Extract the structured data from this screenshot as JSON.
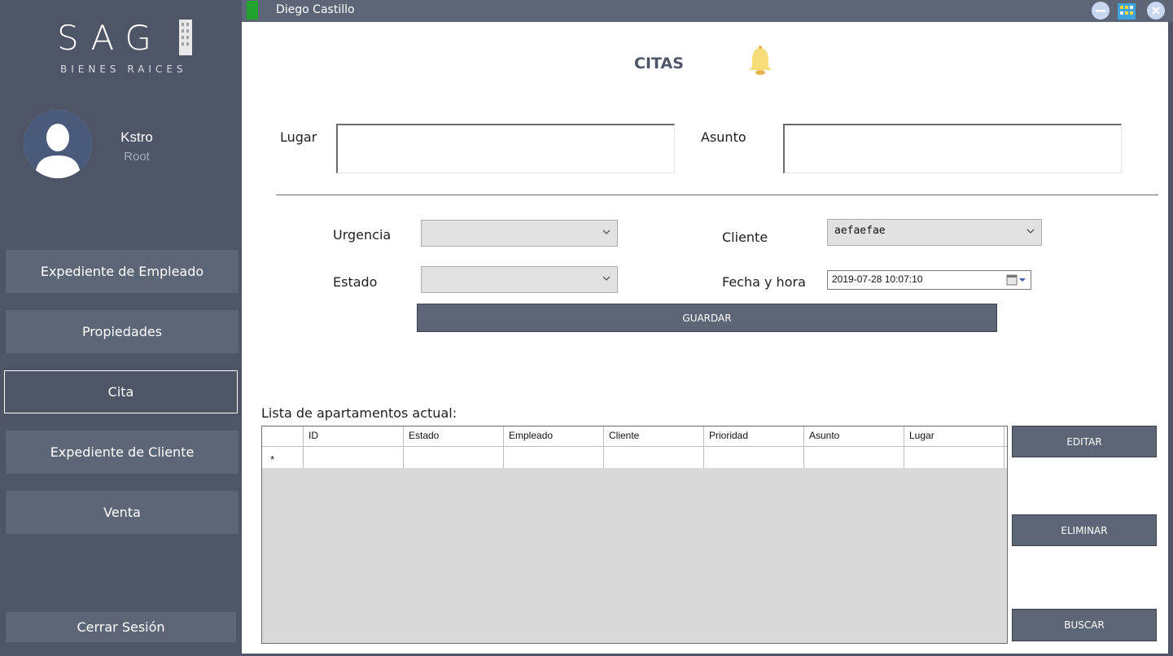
{
  "app": {
    "window_title": "Diego Castillo",
    "logo_text": "SAG",
    "logo_subtitle": "BIENES RAICES",
    "colors": {
      "sidebar": "#4d5566",
      "button": "#5d6676",
      "indicator": "#22a32e",
      "bell": "#f5d76e"
    }
  },
  "user": {
    "name": "Kstro",
    "role": "Root"
  },
  "sidebar": {
    "items": [
      {
        "label": "Expediente de Empleado",
        "active": false
      },
      {
        "label": "Propiedades",
        "active": false
      },
      {
        "label": "Cita",
        "active": true
      },
      {
        "label": "Expediente de Cliente",
        "active": false
      },
      {
        "label": "Venta",
        "active": false
      }
    ],
    "logout_label": "Cerrar Sesión"
  },
  "form": {
    "title": "CITAS",
    "lugar_label": "Lugar",
    "lugar_value": "",
    "asunto_label": "Asunto",
    "asunto_value": "",
    "urgencia_label": "Urgencia",
    "urgencia_value": "",
    "estado_label": "Estado",
    "estado_value": "",
    "cliente_label": "Cliente",
    "cliente_value": "aefaefae",
    "fecha_label": "Fecha y hora",
    "fecha_value": "2019-07-28 10:07:10",
    "save_label": "GUARDAR"
  },
  "list": {
    "title": "Lista de apartamentos actual:",
    "columns": [
      "ID",
      "Estado",
      "Empleado",
      "Cliente",
      "Prioridad",
      "Asunto",
      "Lugar"
    ],
    "new_row_marker": "*"
  },
  "actions": {
    "edit_label": "EDITAR",
    "delete_label": "ELIMINAR",
    "search_label": "BUSCAR"
  },
  "icons": {
    "window_minimize": "minimize-icon",
    "window_maximize": "building-icon",
    "window_close": "close-icon",
    "notification": "bell-icon",
    "dropdown": "chevron-down-icon",
    "calendar": "calendar-icon",
    "user": "avatar-icon"
  }
}
